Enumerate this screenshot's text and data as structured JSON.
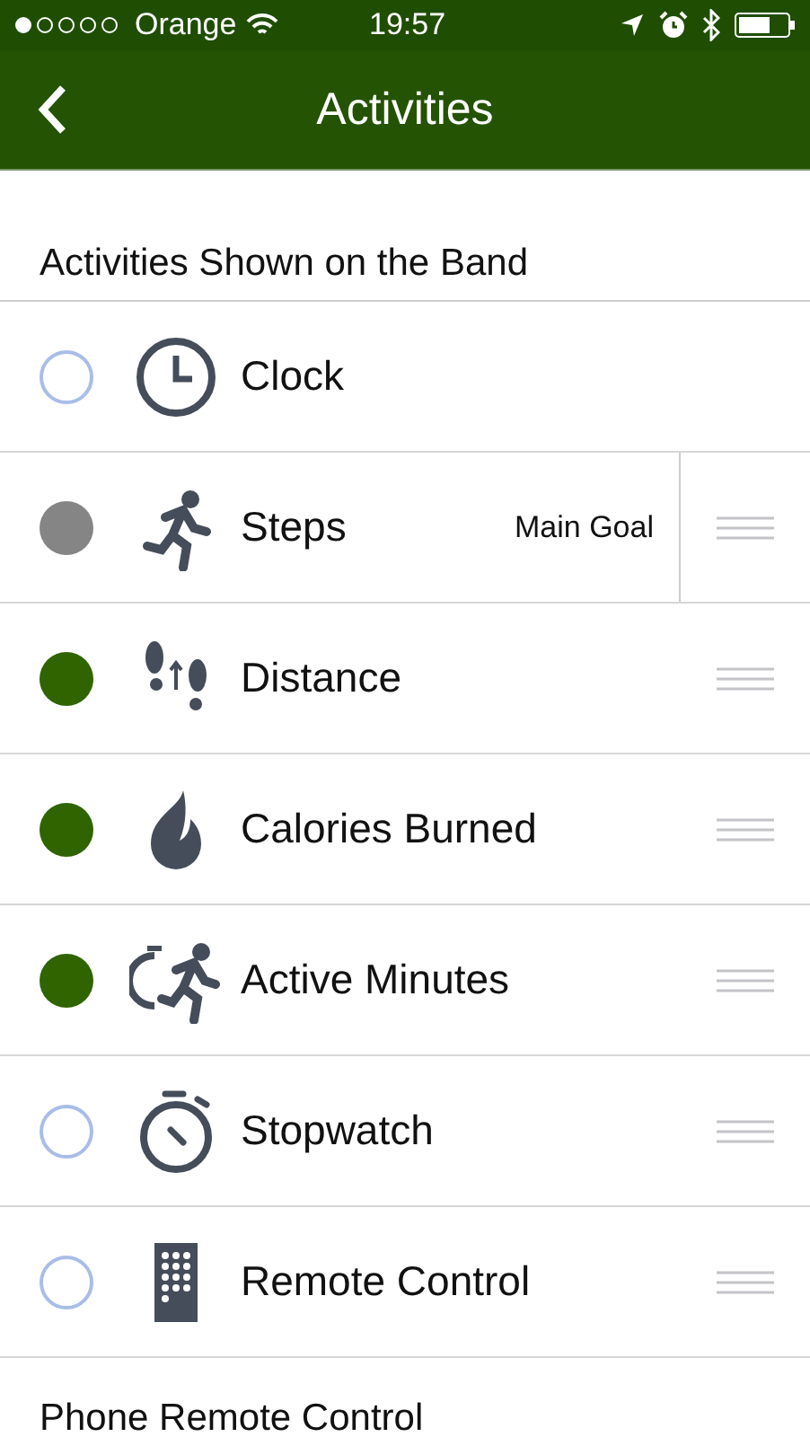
{
  "status_bar": {
    "carrier": "Orange",
    "time": "19:57"
  },
  "nav": {
    "title": "Activities"
  },
  "section": {
    "title": "Activities Shown on the Band"
  },
  "activities": [
    {
      "kind": "clock",
      "label": "Clock",
      "selected": false,
      "main_goal": false,
      "draggable": false
    },
    {
      "kind": "runner",
      "label": "Steps",
      "selected": true,
      "main_goal": true,
      "badge": "Main Goal",
      "draggable": true
    },
    {
      "kind": "footprints",
      "label": "Distance",
      "selected": true,
      "main_goal": false,
      "draggable": true
    },
    {
      "kind": "flame",
      "label": "Calories Burned",
      "selected": true,
      "main_goal": false,
      "draggable": true
    },
    {
      "kind": "timed-runner",
      "label": "Active Minutes",
      "selected": true,
      "main_goal": false,
      "draggable": true
    },
    {
      "kind": "stopwatch",
      "label": "Stopwatch",
      "selected": false,
      "main_goal": false,
      "draggable": true
    },
    {
      "kind": "keypad",
      "label": "Remote Control",
      "selected": false,
      "main_goal": false,
      "draggable": true
    }
  ],
  "next_section": {
    "title": "Phone Remote Control"
  }
}
